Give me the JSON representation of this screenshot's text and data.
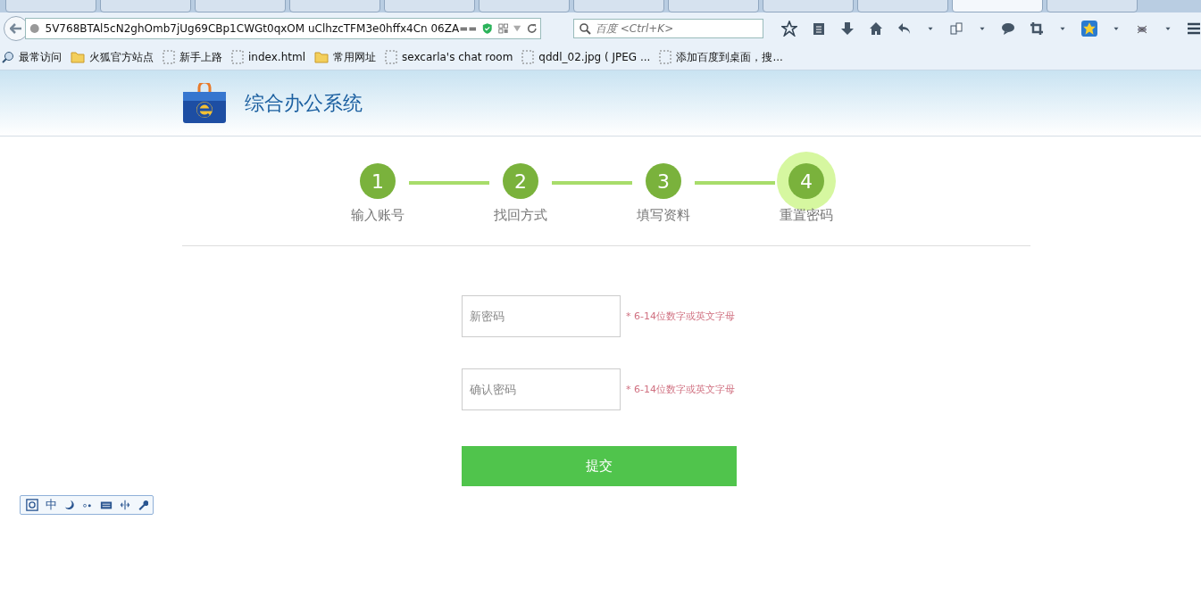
{
  "browser": {
    "tabs": [
      {
        "selected": false
      },
      {
        "selected": false
      },
      {
        "selected": false
      },
      {
        "selected": false
      },
      {
        "selected": false
      },
      {
        "selected": false
      },
      {
        "selected": false
      },
      {
        "selected": false
      },
      {
        "selected": false
      },
      {
        "selected": false
      },
      {
        "selected": true
      },
      {
        "selected": false
      }
    ],
    "url": "5V768BTAl5cN2ghOmb7jUg69CBp1CWGt0qxOM uClhzcTFM3e0hffx4Cn 06ZA==",
    "search_placeholder": "百度 <Ctrl+K>",
    "bookmarks": [
      {
        "label": "最常访问",
        "kind": "special"
      },
      {
        "label": "火狐官方站点",
        "kind": "folder"
      },
      {
        "label": "新手上路",
        "kind": "page"
      },
      {
        "label": "index.html",
        "kind": "page"
      },
      {
        "label": "常用网址",
        "kind": "folder"
      },
      {
        "label": "sexcarla's chat room",
        "kind": "page"
      },
      {
        "label": "qddl_02.jpg ( JPEG ...",
        "kind": "page"
      },
      {
        "label": "添加百度到桌面，搜...",
        "kind": "page"
      }
    ]
  },
  "header": {
    "title": "综合办公系统"
  },
  "steps": [
    {
      "number": "1",
      "label": "输入账号",
      "selected": false
    },
    {
      "number": "2",
      "label": "找回方式",
      "selected": false
    },
    {
      "number": "3",
      "label": "填写资料",
      "selected": false
    },
    {
      "number": "4",
      "label": "重置密码",
      "selected": true
    }
  ],
  "fields": [
    {
      "placeholder": "新密码",
      "hint": "* 6-14位数字或英文字母"
    },
    {
      "placeholder": "确认密码",
      "hint": "* 6-14位数字或英文字母"
    }
  ],
  "submit": "提交",
  "ime_toolbar": {
    "mode": "中"
  }
}
